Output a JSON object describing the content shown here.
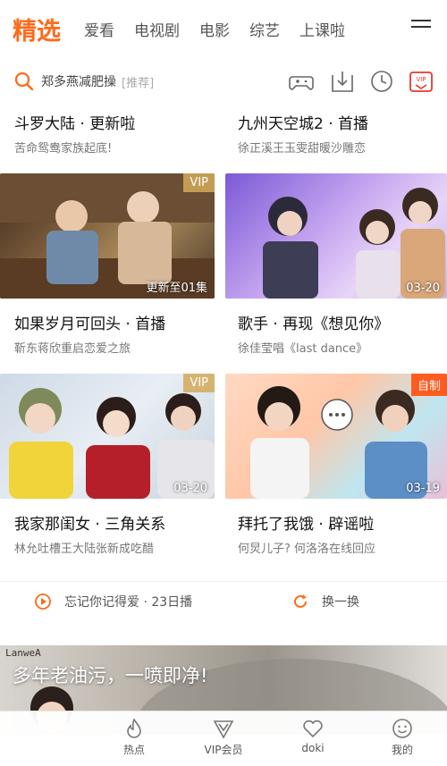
{
  "nav": {
    "tabs": [
      "精选",
      "爱看",
      "电视剧",
      "电影",
      "综艺",
      "上课啦"
    ]
  },
  "search": {
    "placeholder": "郑多燕减肥操",
    "tag": "[推荐]"
  },
  "icons": {
    "game": "gamepad-icon",
    "download": "download-icon",
    "history": "clock-icon",
    "vip": "vip-icon",
    "vip_label": "VIP"
  },
  "row1": [
    {
      "title": "斗罗大陆 · 更新啦",
      "subtitle": "苦命鸳鸯家族起底!"
    },
    {
      "title": "九州天空城2 · 首播",
      "subtitle": "徐正溪王玉雯甜暖沙雕恋"
    }
  ],
  "row2": [
    {
      "badge": "VIP",
      "caption": "更新至01集",
      "title": "如果岁月可回头 · 首播",
      "subtitle": "靳东蒋欣重启恋爱之旅"
    },
    {
      "badge": "",
      "caption": "03-20",
      "title": "歌手 · 再现《想见你》",
      "subtitle": "徐佳莹唱《last dance》"
    }
  ],
  "row3": [
    {
      "badge": "VIP",
      "caption": "03-20",
      "title": "我家那闺女 · 三角关系",
      "subtitle": "林允吐槽王大陆张新成吃醋"
    },
    {
      "badge": "自制",
      "caption": "03-19",
      "title": "拜托了我饿 · 辟谣啦",
      "subtitle": "何炅儿子? 何洛洛在线回应"
    }
  ],
  "links": {
    "play": "忘记你记得爱 · 23日播",
    "refresh": "换一换"
  },
  "banner": {
    "brand": "LanweA",
    "slogan": "多年老油污，一喷即净!"
  },
  "bottomnav": [
    "热点",
    "VIP会员",
    "doki",
    "我的"
  ],
  "colors": {
    "accent": "#ff6a1a",
    "vip_red": "#e3392f"
  }
}
